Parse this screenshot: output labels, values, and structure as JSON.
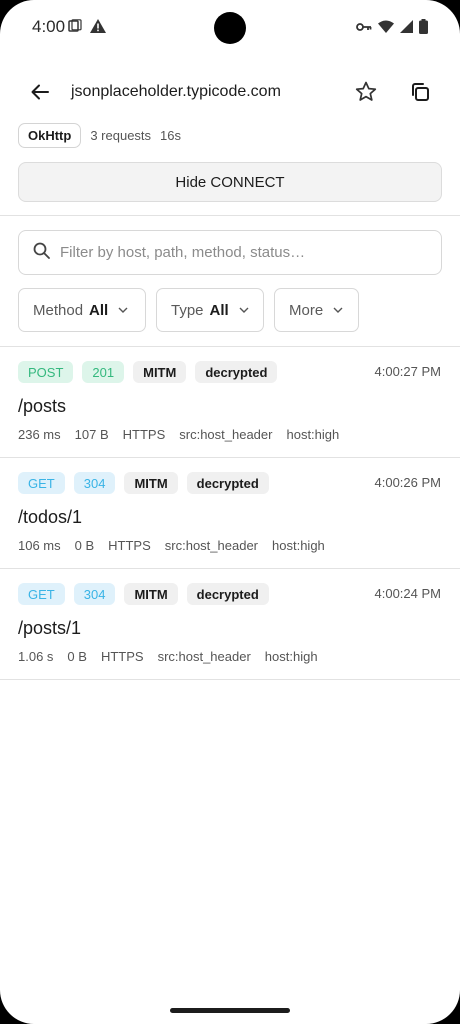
{
  "status_bar": {
    "time": "4:00"
  },
  "header": {
    "title": "jsonplaceholder.typicode.com"
  },
  "meta": {
    "client": "OkHttp",
    "requests": "3 requests",
    "duration": "16s"
  },
  "hide_connect_label": "Hide CONNECT",
  "search": {
    "placeholder": "Filter by host, path, method, status…"
  },
  "filters": [
    {
      "label": "Method",
      "value": "All"
    },
    {
      "label": "Type",
      "value": "All"
    },
    {
      "label": "More",
      "value": ""
    }
  ],
  "requests": [
    {
      "method": "POST",
      "status": "201",
      "tag1": "MITM",
      "tag2": "decrypted",
      "time": "4:00:27 PM",
      "path": "/posts",
      "meta": [
        "236 ms",
        "107 B",
        "HTTPS",
        "src:host_header",
        "host:high"
      ]
    },
    {
      "method": "GET",
      "status": "304",
      "tag1": "MITM",
      "tag2": "decrypted",
      "time": "4:00:26 PM",
      "path": "/todos/1",
      "meta": [
        "106 ms",
        "0 B",
        "HTTPS",
        "src:host_header",
        "host:high"
      ]
    },
    {
      "method": "GET",
      "status": "304",
      "tag1": "MITM",
      "tag2": "decrypted",
      "time": "4:00:24 PM",
      "path": "/posts/1",
      "meta": [
        "1.06 s",
        "0 B",
        "HTTPS",
        "src:host_header",
        "host:high"
      ]
    }
  ],
  "colors": {
    "post_green": "#34b87e",
    "get_blue": "#3ab4e6"
  }
}
